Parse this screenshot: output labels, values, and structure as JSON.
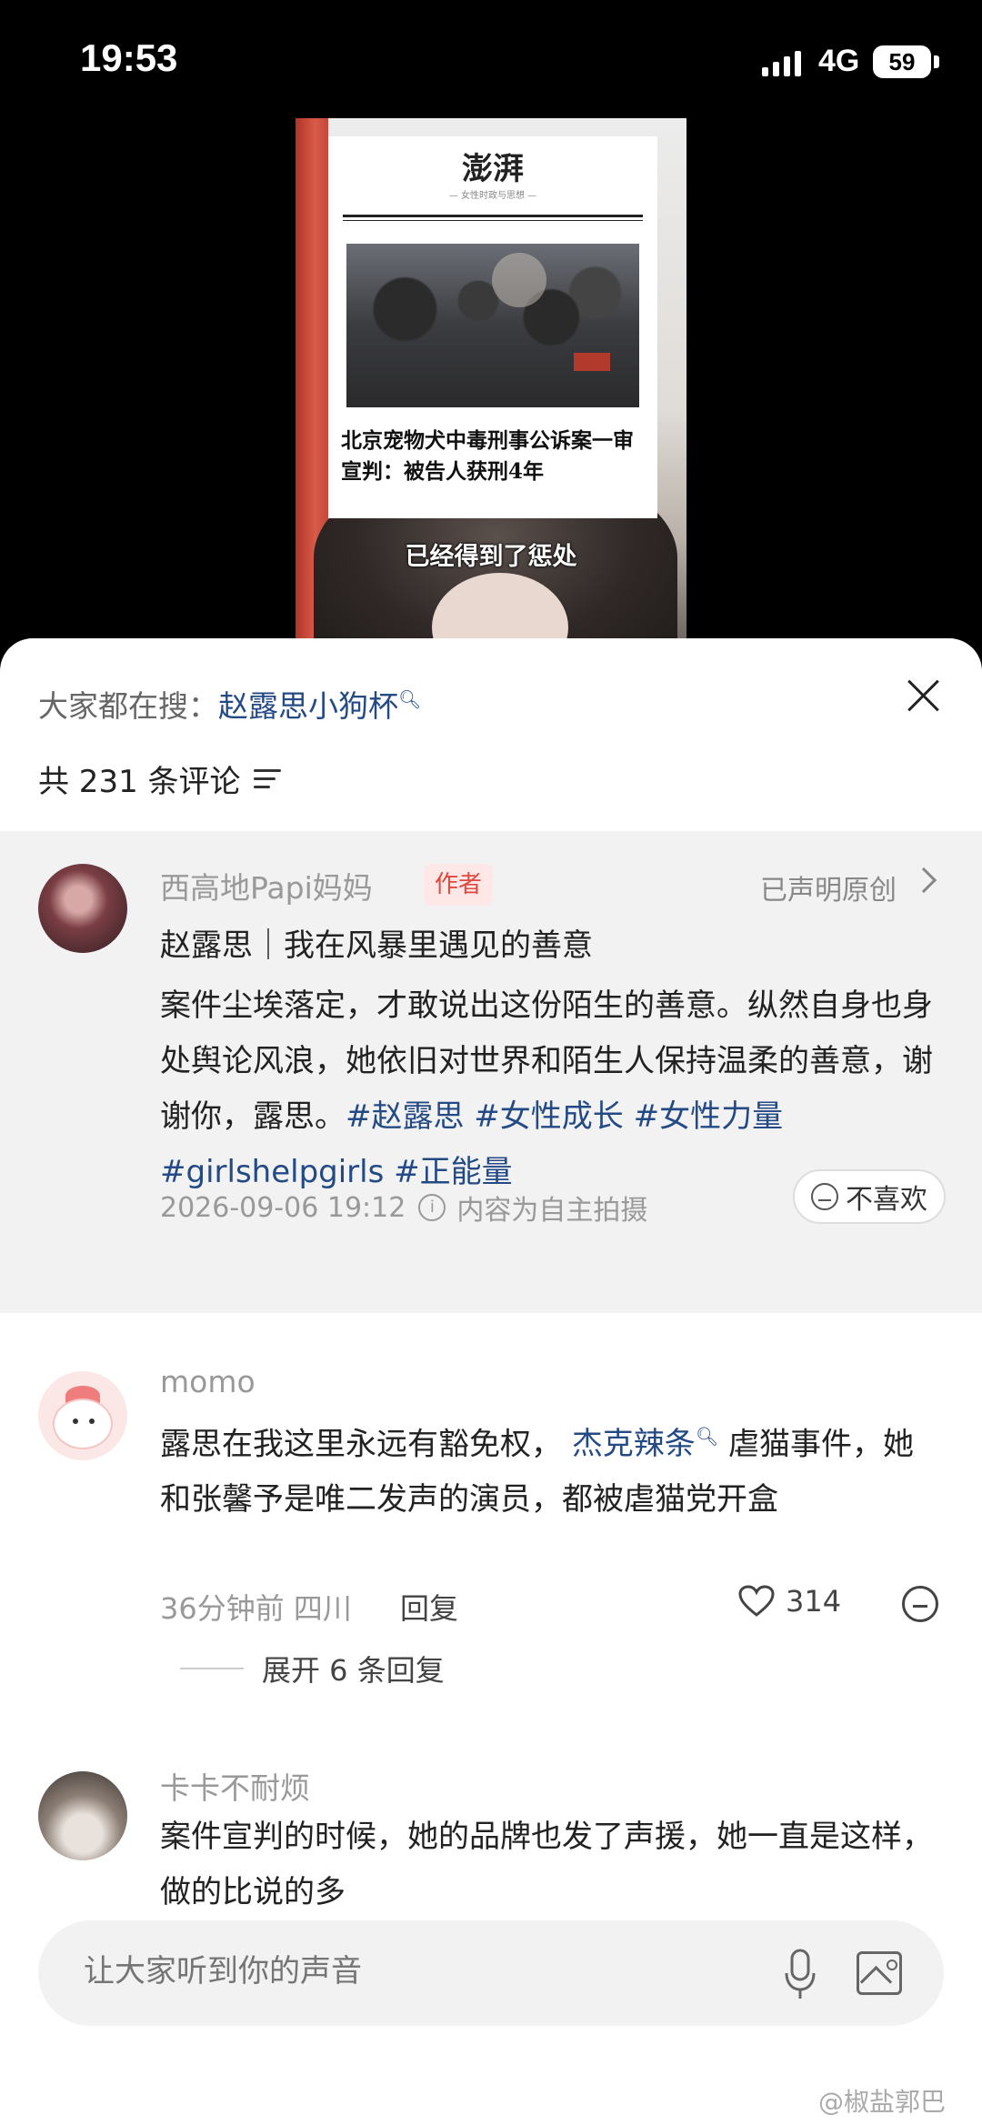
{
  "status": {
    "time": "19:53",
    "network": "4G",
    "battery": "59"
  },
  "video": {
    "logo": "澎湃",
    "tagline": "— 女性时政与思想 —",
    "headline": "北京宠物犬中毒刑事公诉案一审宣判：被告人获刑4年",
    "subtitle": "已经得到了惩处"
  },
  "panel": {
    "hot_search_label": "大家都在搜：",
    "hot_search_term": "赵露思小狗杯",
    "comment_count": "共 231 条评论"
  },
  "author_post": {
    "username": "西高地Papi妈妈",
    "badge": "作者",
    "declaration": "已声明原创",
    "title": "赵露思｜我在风暴里遇见的善意",
    "body": "案件尘埃落定，才敢说出这份陌生的善意。纵然自身也身处舆论风浪，她依旧对世界和陌生人保持温柔的善意，谢谢你，露思。",
    "tags": "#赵露思 #女性成长 #女性力量 #girlshelpgirls #正能量",
    "timestamp": "2026-09-06 19:12",
    "content_note": "内容为自主拍摄",
    "dislike_label": "不喜欢"
  },
  "comments": [
    {
      "username": "momo",
      "text_before": "露思在我这里永远有豁免权，",
      "mention": "杰克辣条",
      "text_after": "虐猫事件，她和张馨予是唯二发声的演员，都被虐猫党开盒",
      "meta": "36分钟前 四川",
      "reply_label": "回复",
      "likes": "314",
      "expand_label": "展开 6 条回复"
    },
    {
      "username": "卡卡不耐烦",
      "text": "案件宣判的时候，她的品牌也发了声援，她一直是这样，做的比说的多"
    }
  ],
  "input": {
    "placeholder": "让大家听到你的声音"
  },
  "watermark": "@椒盐郭巴"
}
